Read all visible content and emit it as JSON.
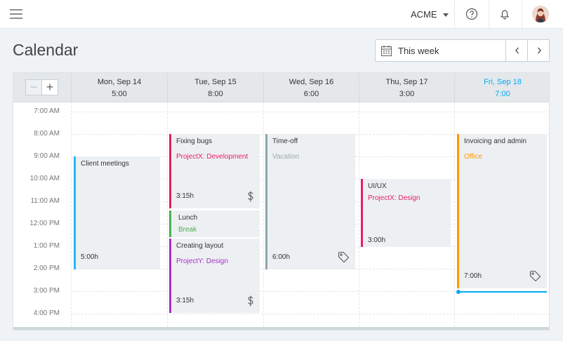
{
  "topbar": {
    "workspace": "ACME",
    "help_icon": "help-circle-icon",
    "bell_icon": "bell-icon",
    "menu_icon": "hamburger-icon"
  },
  "page": {
    "title": "Calendar"
  },
  "range": {
    "label": "This week",
    "prev": "‹",
    "next": "›"
  },
  "zoom": {
    "minus": "−",
    "plus": "+"
  },
  "days": [
    {
      "date": "Mon, Sep 14",
      "hours": "5:00",
      "today": false
    },
    {
      "date": "Tue, Sep 15",
      "hours": "8:00",
      "today": false
    },
    {
      "date": "Wed, Sep 16",
      "hours": "6:00",
      "today": false
    },
    {
      "date": "Thu, Sep 17",
      "hours": "3:00",
      "today": false
    },
    {
      "date": "Fri, Sep 18",
      "hours": "7:00",
      "today": true
    }
  ],
  "hours": [
    "7:00 AM",
    "8:00 AM",
    "9:00 AM",
    "10:00 AM",
    "11:00 AM",
    "12:00 PM",
    "1:00 PM",
    "2:00 PM",
    "3:00 PM",
    "4:00 PM"
  ],
  "events": [
    {
      "title": "Client meetings",
      "project": "",
      "duration": "5:00h",
      "color": "#29b6f6",
      "project_color": "#29b6f6",
      "icon": ""
    },
    {
      "title": "Fixing bugs",
      "project": "ProjectX: Development",
      "duration": "3:15h",
      "color": "#e91e63",
      "project_color": "#e91e63",
      "icon": "dollar-icon"
    },
    {
      "title": "Lunch",
      "project": "Break",
      "duration": "",
      "color": "#4caf50",
      "project_color": "#4caf50",
      "icon": ""
    },
    {
      "title": "Creating layout",
      "project": "ProjectY: Design",
      "duration": "3:15h",
      "color": "#ab2fc8",
      "project_color": "#ab2fc8",
      "icon": "dollar-icon"
    },
    {
      "title": "Time-off",
      "project": "Vacation",
      "duration": "6:00h",
      "color": "#90a4ae",
      "project_color": "#a0a8ad",
      "icon": "tag-icon"
    },
    {
      "title": "UI/UX",
      "project": "ProjectX: Design",
      "duration": "3:00h",
      "color": "#e91e63",
      "project_color": "#e91e63",
      "icon": ""
    },
    {
      "title": "Invoicing and admin",
      "project": "Office",
      "duration": "7:00h",
      "color": "#ff9800",
      "project_color": "#ff9800",
      "icon": "tag-icon"
    }
  ]
}
